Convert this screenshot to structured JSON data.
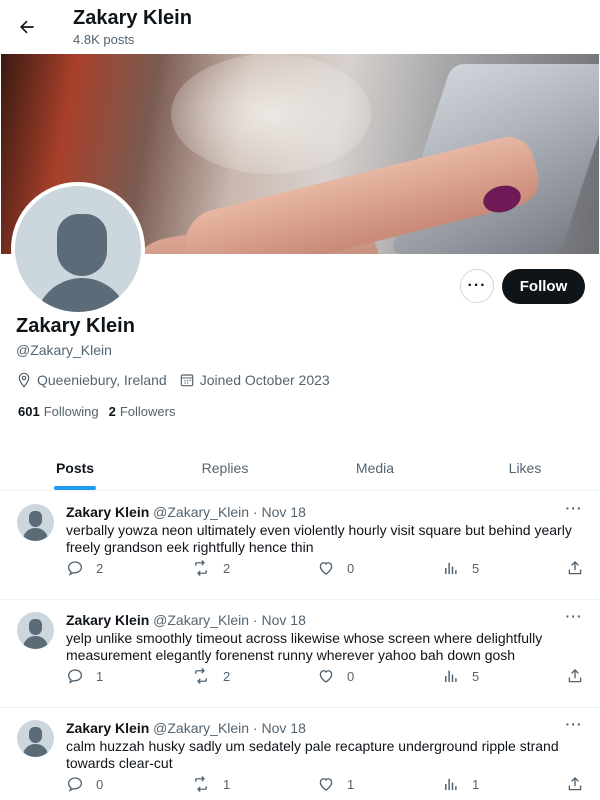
{
  "header": {
    "title": "Zakary Klein",
    "subtitle": "4.8K posts"
  },
  "profile": {
    "name": "Zakary Klein",
    "handle": "@Zakary_Klein",
    "location": "Queeniebury, Ireland",
    "joined": "Joined October 2023",
    "following_count": "601",
    "following_label": "Following",
    "followers_count": "2",
    "followers_label": "Followers",
    "follow_label": "Follow",
    "more_label": "···"
  },
  "tabs": [
    {
      "label": "Posts",
      "active": true
    },
    {
      "label": "Replies",
      "active": false
    },
    {
      "label": "Media",
      "active": false
    },
    {
      "label": "Likes",
      "active": false
    }
  ],
  "posts": [
    {
      "name": "Zakary Klein",
      "handle_date": "@Zakary_Klein · Nov 18",
      "text": "verbally yowza neon ultimately even violently hourly visit square but behind yearly freely grandson eek rightfully hence thin",
      "replies": "2",
      "reposts": "2",
      "likes": "0",
      "views": "5"
    },
    {
      "name": "Zakary Klein",
      "handle_date": "@Zakary_Klein · Nov 18",
      "text": "yelp unlike smoothly timeout across likewise whose screen where delightfully measurement elegantly forenenst runny wherever yahoo bah down gosh",
      "replies": "1",
      "reposts": "2",
      "likes": "0",
      "views": "5"
    },
    {
      "name": "Zakary Klein",
      "handle_date": "@Zakary_Klein · Nov 18",
      "text": "calm huzzah husky sadly um sedately pale recapture underground ripple strand towards clear-cut",
      "replies": "0",
      "reposts": "1",
      "likes": "1",
      "views": "1"
    }
  ],
  "colors": {
    "accent": "#1d9bf0",
    "text": "#0f1419",
    "muted": "#536471",
    "follow_bg": "#0f1419"
  },
  "icons": {
    "back": "arrow-left-icon",
    "location": "location-pin-icon",
    "calendar": "calendar-icon",
    "reply": "reply-icon",
    "repost": "repost-icon",
    "like": "heart-icon",
    "views": "views-icon",
    "share": "share-icon"
  }
}
